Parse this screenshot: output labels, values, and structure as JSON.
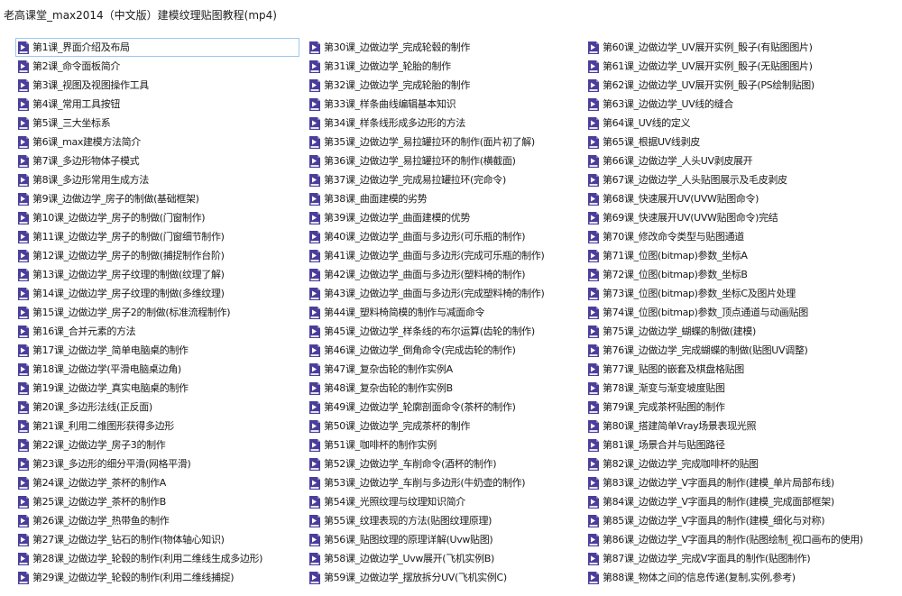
{
  "window": {
    "title": "老高课堂_max2014（中文版）建模纹理贴图教程(mp4)"
  },
  "file_icon": "video-file-icon",
  "colors": {
    "icon_body": "#4b3e9a",
    "icon_fold": "#8c86c2",
    "selection_border": "#99c9ef"
  },
  "columns": [
    {
      "items": [
        {
          "label": "第1课_界面介绍及布局",
          "selected": true
        },
        {
          "label": "第2课_命令面板简介"
        },
        {
          "label": "第3课_视图及视图操作工具"
        },
        {
          "label": "第4课_常用工具按钮"
        },
        {
          "label": "第5课_三大坐标系"
        },
        {
          "label": "第6课_max建模方法简介"
        },
        {
          "label": "第7课_多边形物体子模式"
        },
        {
          "label": "第8课_多边形常用生成方法"
        },
        {
          "label": "第9课_边做边学_房子的制做(基础框架)"
        },
        {
          "label": "第10课_边做边学_房子的制做(门窗制作)"
        },
        {
          "label": "第11课_边做边学_房子的制做(门窗细节制作)"
        },
        {
          "label": "第12课_边做边学_房子的制做(捕捉制作台阶)"
        },
        {
          "label": "第13课_边做边学_房子纹理的制做(纹理了解)"
        },
        {
          "label": "第14课_边做边学_房子纹理的制做(多维纹理)"
        },
        {
          "label": "第15课_边做边学_房子2的制做(标准流程制作)"
        },
        {
          "label": "第16课_合并元素的方法"
        },
        {
          "label": "第17课_边做边学_简单电脑桌的制作"
        },
        {
          "label": "第18课_边做边学(平滑电脑桌边角)"
        },
        {
          "label": "第19课_边做边学_真实电脑桌的制作"
        },
        {
          "label": "第20课_多边形法线(正反面)"
        },
        {
          "label": "第21课_利用二维图形获得多边形"
        },
        {
          "label": "第22课_边做边学_房子3的制作"
        },
        {
          "label": "第23课_多边形的细分平滑(网格平滑)"
        },
        {
          "label": "第24课_边做边学_茶杯的制作A"
        },
        {
          "label": "第25课_边做边学_茶杯的制作B"
        },
        {
          "label": "第26课_边做边学_热带鱼的制作"
        },
        {
          "label": "第27课_边做边学_钻石的制作(物体轴心知识)"
        },
        {
          "label": "第28课_边做边学_轮毂的制作(利用二维线生成多边形)"
        },
        {
          "label": "第29课_边做边学_轮毂的制作(利用二维线捕捉)"
        }
      ]
    },
    {
      "items": [
        {
          "label": "第30课_边做边学_完成轮毂的制作"
        },
        {
          "label": "第31课_边做边学_轮胎的制作"
        },
        {
          "label": "第32课_边做边学_完成轮胎的制作"
        },
        {
          "label": "第33课_样条曲线编辑基本知识"
        },
        {
          "label": "第34课_样条线形成多边形的方法"
        },
        {
          "label": "第35课_边做边学_易拉罐拉环的制作(面片初了解)"
        },
        {
          "label": "第36课_边做边学_易拉罐拉环的制作(横截面)"
        },
        {
          "label": "第37课_边做边学_完成易拉罐拉环(完命令)"
        },
        {
          "label": "第38课_曲面建模的劣势"
        },
        {
          "label": "第39课_边做边学_曲面建模的优势"
        },
        {
          "label": "第40课_边做边学_曲面与多边形(可乐瓶的制作)"
        },
        {
          "label": "第41课_边做边学_曲面与多边形(完成可乐瓶的制作)"
        },
        {
          "label": "第42课_边做边学_曲面与多边形(塑料椅的制作)"
        },
        {
          "label": "第43课_边做边学_曲面与多边形(完成塑料椅的制作)"
        },
        {
          "label": "第44课_塑料椅简模的制作与减面命令"
        },
        {
          "label": "第45课_边做边学_样条线的布尔运算(齿轮的制作)"
        },
        {
          "label": "第46课_边做边学_倒角命令(完成齿轮的制作)"
        },
        {
          "label": "第47课_复杂齿轮的制作实例A"
        },
        {
          "label": "第48课_复杂齿轮的制作实例B"
        },
        {
          "label": "第49课_边做边学_轮廓剖面命令(茶杯的制作)"
        },
        {
          "label": "第50课_边做边学_完成茶杯的制作"
        },
        {
          "label": "第51课_咖啡杯的制作实例"
        },
        {
          "label": "第52课_边做边学_车削命令(酒杯的制作)"
        },
        {
          "label": "第53课_边做边学_车削与多边形(牛奶壶的制作)"
        },
        {
          "label": "第54课_光照纹理与纹理知识简介"
        },
        {
          "label": "第55课_纹理表现的方法(贴图纹理原理)"
        },
        {
          "label": "第56课_贴图纹理的原理详解(Uvw贴图)"
        },
        {
          "label": "第58课_边做边学_Uvw展开(飞机实例B)"
        },
        {
          "label": "第59课_边做边学_摆放拆分UV(飞机实例C)"
        }
      ]
    },
    {
      "items": [
        {
          "label": "第60课_边做边学_UV展开实例_骰子(有贴图图片)"
        },
        {
          "label": "第61课_边做边学_UV展开实例_骰子(无贴图图片)"
        },
        {
          "label": "第62课_边做边学_UV展开实例_骰子(PS绘制贴图)"
        },
        {
          "label": "第63课_边做边学_UV线的缝合"
        },
        {
          "label": "第64课_UV线的定义"
        },
        {
          "label": "第65课_根据UV线剥皮"
        },
        {
          "label": "第66课_边做边学_人头UV剥皮展开"
        },
        {
          "label": "第67课_边做边学_人头贴图展示及毛皮剥皮"
        },
        {
          "label": "第68课_快速展开UV(UVW贴图命令)"
        },
        {
          "label": "第69课_快速展开UV(UVW贴图命令)完结"
        },
        {
          "label": "第70课_修改命令类型与贴图通道"
        },
        {
          "label": "第71课_位图(bitmap)参数_坐标A"
        },
        {
          "label": "第72课_位图(bitmap)参数_坐标B"
        },
        {
          "label": "第73课_位图(bitmap)参数_坐标C及图片处理"
        },
        {
          "label": "第74课_位图(bitmap)参数_顶点通道与动画贴图"
        },
        {
          "label": "第75课_边做边学_蝴蝶的制做(建模)"
        },
        {
          "label": "第76课_边做边学_完成蝴蝶的制做(贴图UV调整)"
        },
        {
          "label": "第77课_贴图的嵌套及棋盘格贴图"
        },
        {
          "label": "第78课_渐变与渐变坡度贴图"
        },
        {
          "label": "第79课_完成茶杯贴图的制作"
        },
        {
          "label": "第80课_搭建简单Vray场景表现光照"
        },
        {
          "label": "第81课_场景合并与贴图路径"
        },
        {
          "label": "第82课_边做边学_完成咖啡杯的贴图"
        },
        {
          "label": "第83课_边做边学_V字面具的制作(建模_单片局部布线)"
        },
        {
          "label": "第84课_边做边学_V字面具的制作(建模_完成面部框架)"
        },
        {
          "label": "第85课_边做边学_V字面具的制作(建模_细化与对称)"
        },
        {
          "label": "第86课_边做边学_V字面具的制作(贴图绘制_视口画布的使用)"
        },
        {
          "label": "第87课_边做边学_完成V字面具的制作(贴图制作)"
        },
        {
          "label": "第88课_物体之间的信息传递(复制,实例,参考)"
        }
      ]
    }
  ]
}
